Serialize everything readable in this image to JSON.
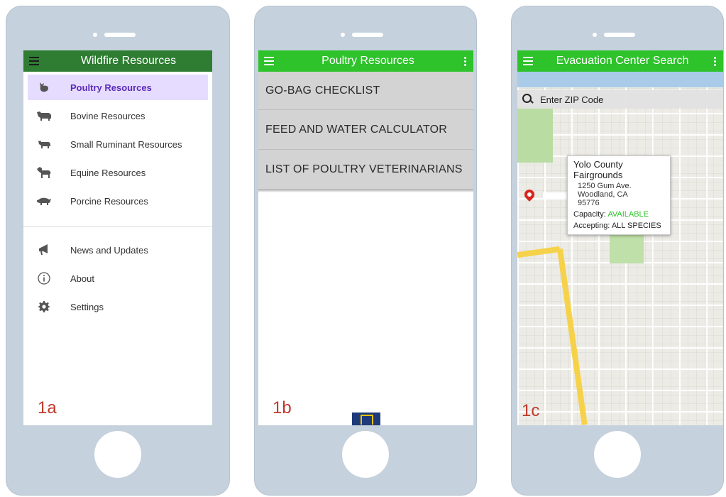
{
  "phone_a": {
    "title": "Wildfire Resources",
    "label": "1a",
    "colors": {
      "appbar": "#2e7d32",
      "active_bg": "#e6dcff",
      "active_text": "#5b2ab8"
    },
    "primary_items": [
      {
        "label": "Poultry Resources",
        "icon": "chicken-icon"
      },
      {
        "label": "Bovine Resources",
        "icon": "cow-icon"
      },
      {
        "label": "Small Ruminant Resources",
        "icon": "sheep-icon"
      },
      {
        "label": "Equine Resources",
        "icon": "horse-icon"
      },
      {
        "label": "Porcine Resources",
        "icon": "pig-icon"
      }
    ],
    "secondary_items": [
      {
        "label": "News and Updates",
        "icon": "megaphone-icon"
      },
      {
        "label": "About",
        "icon": "info-icon"
      },
      {
        "label": "Settings",
        "icon": "gear-icon"
      }
    ]
  },
  "phone_b": {
    "title": "Poultry Resources",
    "label": "1b",
    "colors": {
      "appbar": "#2ec22b"
    },
    "items": [
      "GO-BAG CHECKLIST",
      "FEED AND WATER CALCULATOR",
      "LIST OF POULTRY VETERINARIANS"
    ]
  },
  "phone_c": {
    "title": "Evacuation Center Search",
    "label": "1c",
    "colors": {
      "appbar": "#2ec22b",
      "available": "#2ec22b",
      "pin": "#d9261c"
    },
    "search": {
      "placeholder": "Enter ZIP Code"
    },
    "info": {
      "name": "Yolo County Fairgrounds",
      "address_line1": "1250 Gum Ave.",
      "address_line2": "Woodland, CA",
      "address_line3": "95776",
      "capacity_label": "Capacity:",
      "capacity_value": "AVAILABLE",
      "accepting_label": "Accepting:",
      "accepting_value": "ALL SPECIES"
    }
  }
}
